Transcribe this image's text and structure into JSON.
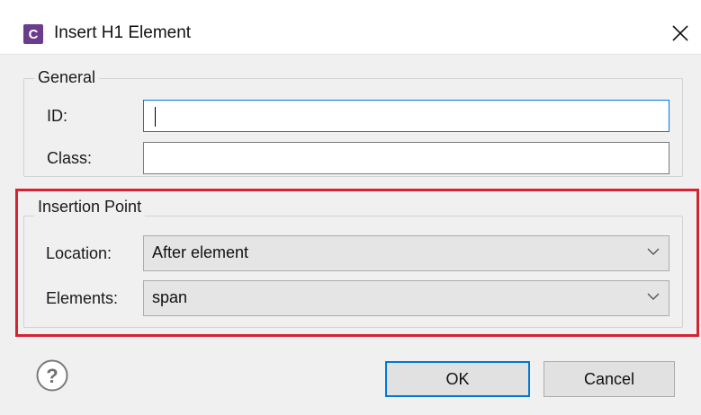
{
  "window": {
    "app_icon_letter": "C",
    "title": "Insert H1 Element",
    "close_icon": "close-icon"
  },
  "general": {
    "legend": "General",
    "id_label": "ID:",
    "id_value": "",
    "class_label": "Class:",
    "class_value": ""
  },
  "insertion_point": {
    "legend": "Insertion Point",
    "location_label": "Location:",
    "location_value": "After element",
    "elements_label": "Elements:",
    "elements_value": "span"
  },
  "footer": {
    "help_icon": "help-icon",
    "ok_label": "OK",
    "cancel_label": "Cancel"
  },
  "colors": {
    "highlight_border": "#d42331",
    "focus_border": "#0078d7",
    "app_icon_bg": "#6a3c8c"
  }
}
